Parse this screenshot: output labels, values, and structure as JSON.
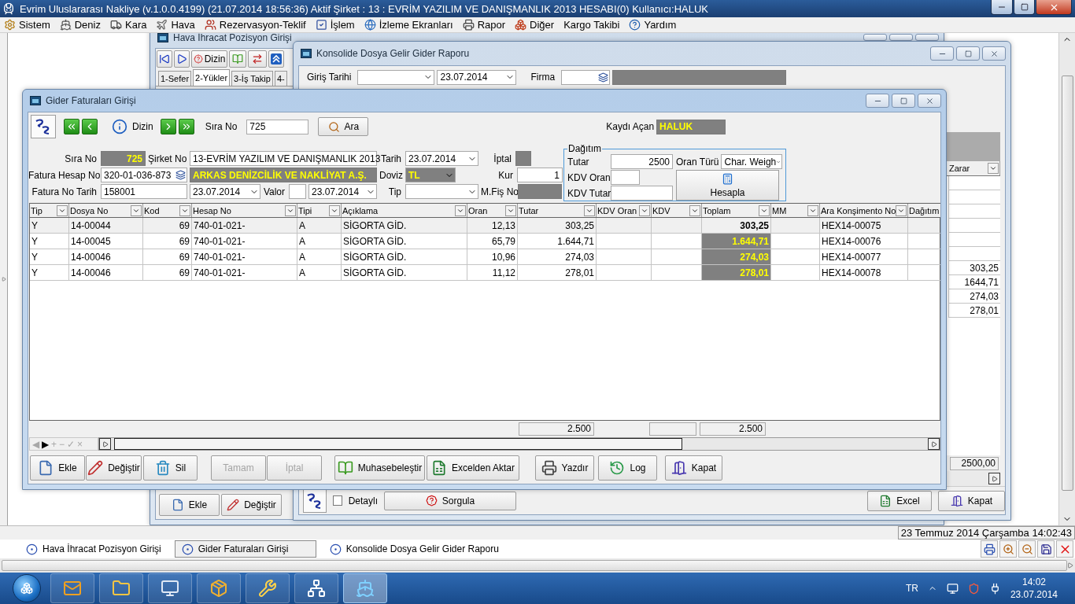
{
  "app": {
    "title": "Evrim Uluslararası Nakliye (v.1.0.0.4199) (21.07.2014 18:56:36) Aktif Şirket : 13 : EVRİM YAZILIM VE DANIŞMANLIK 2013 HESABI(0) Kullanıcı:HALUK"
  },
  "menu": [
    "Sistem",
    "Deniz",
    "Kara",
    "Hava",
    "Rezervasyon-Teklif",
    "İşlem",
    "İzleme Ekranları",
    "Rapor",
    "Diğer",
    "Kargo Takibi",
    "Yardım"
  ],
  "hava_window": {
    "title": "Hava İhracat Pozisyon Girişi",
    "index_button": "Dizin",
    "tabs": [
      {
        "label": "1-Sefer",
        "selected": false
      },
      {
        "label": "2-Yükler",
        "selected": true
      },
      {
        "label": "3-İş Takip",
        "selected": false
      },
      {
        "label": "4-",
        "selected": false
      }
    ],
    "buttons": [
      "Ekle",
      "Değiştir"
    ]
  },
  "konsolide_window": {
    "title": "Konsolide Dosya Gelir Gider Raporu",
    "date_label": "Giriş Tarihi",
    "date_to": "23.07.2014",
    "firma_label": "Firma",
    "column": "Zarar",
    "values": [
      "303,25",
      "1644,71",
      "274,03",
      "278,01"
    ],
    "total": "2500,00",
    "detayli": {
      "label": "Detaylı",
      "checked": false
    },
    "query_button": "Sorgula",
    "buttons": [
      "Excel",
      "Kapat"
    ]
  },
  "gider_window": {
    "title": "Gider Faturaları Girişi",
    "index_button": "Dizin",
    "search_label": "Sıra No",
    "search_value": "725",
    "search_button": "Ara",
    "opened_by_label": "Kaydı Açan",
    "opened_by": "HALUK",
    "form": {
      "sira_no": {
        "label": "Sıra No",
        "value": "725"
      },
      "sirket_no": {
        "label": "Şirket No",
        "value": "13-EVRİM YAZILIM VE DANIŞMANLIK 2013"
      },
      "tarih": {
        "label": "Tarih",
        "value": "23.07.2014"
      },
      "iptal": {
        "label": "İptal"
      },
      "fatura_hesap_no": {
        "label": "Fatura Hesap No",
        "value": "320-01-036-873"
      },
      "firma": {
        "value": "ARKAS DENİZCİLİK VE NAKLİYAT A.Ş."
      },
      "doviz": {
        "label": "Doviz",
        "value": "TL"
      },
      "kur": {
        "label": "Kur",
        "value": "1"
      },
      "fatura_no_tarih": {
        "label": "Fatura No Tarih",
        "value": "158001",
        "date": "23.07.2014"
      },
      "valor": {
        "label": "Valor",
        "date": "23.07.2014"
      },
      "tip": {
        "label": "Tip"
      },
      "mfis_no": {
        "label": "M.Fiş No"
      }
    },
    "dagitim": {
      "title": "Dağıtım",
      "tutar": {
        "label": "Tutar",
        "value": "2500"
      },
      "oran_turu": {
        "label": "Oran Türü",
        "value": "Char. Weigh"
      },
      "kdv_oran": {
        "label": "KDV Oran"
      },
      "kdv_tutar": {
        "label": "KDV Tutar"
      },
      "button": "Hesapla"
    },
    "table": {
      "columns": [
        "Tip",
        "Dosya No",
        "Kod",
        "Hesap No",
        "Tipi",
        "Açıklama",
        "Oran",
        "Tutar",
        "KDV Oran",
        "KDV",
        "Toplam",
        "MM",
        "Ara Konşimento No",
        "Dağıtım"
      ],
      "rows": [
        {
          "tip": "Y",
          "dosya_no": "14-00044",
          "kod": "69",
          "hesap_no": "740-01-021-",
          "tipi": "A",
          "aciklama": "SİGORTA GİD.",
          "oran": "12,13",
          "tutar": "303,25",
          "toplam": "303,25",
          "ara_konsimento_no": "HEX14-00075",
          "selected": true
        },
        {
          "tip": "Y",
          "dosya_no": "14-00045",
          "kod": "69",
          "hesap_no": "740-01-021-",
          "tipi": "A",
          "aciklama": "SİGORTA GİD.",
          "oran": "65,79",
          "tutar": "1.644,71",
          "toplam": "1.644,71",
          "ara_konsimento_no": "HEX14-00076",
          "selected": false
        },
        {
          "tip": "Y",
          "dosya_no": "14-00046",
          "kod": "69",
          "hesap_no": "740-01-021-",
          "tipi": "A",
          "aciklama": "SİGORTA GİD.",
          "oran": "10,96",
          "tutar": "274,03",
          "toplam": "274,03",
          "ara_konsimento_no": "HEX14-00077",
          "selected": false
        },
        {
          "tip": "Y",
          "dosya_no": "14-00046",
          "kod": "69",
          "hesap_no": "740-01-021-",
          "tipi": "A",
          "aciklama": "SİGORTA GİD.",
          "oran": "11,12",
          "tutar": "278,01",
          "toplam": "278,01",
          "ara_konsimento_no": "HEX14-00078",
          "selected": false
        }
      ],
      "totals": {
        "tutar": "2.500",
        "toplam": "2.500"
      }
    },
    "navigator": [
      {
        "symbol": "◀",
        "disabled": true
      },
      {
        "symbol": "▶",
        "disabled": false
      },
      {
        "symbol": "+",
        "disabled": true
      },
      {
        "symbol": "−",
        "disabled": true
      },
      {
        "symbol": "✓",
        "disabled": true
      },
      {
        "symbol": "×",
        "disabled": true
      }
    ],
    "buttons": [
      {
        "label": "Ekle",
        "disabled": false
      },
      {
        "label": "Değiştir",
        "disabled": false
      },
      {
        "label": "Sil",
        "disabled": false
      },
      {
        "label": "Tamam",
        "disabled": true
      },
      {
        "label": "İptal",
        "disabled": true
      },
      {
        "label": "Muhasebeleştir",
        "disabled": false
      },
      {
        "label": "Excelden Aktar",
        "disabled": false
      },
      {
        "label": "Yazdır",
        "disabled": false
      },
      {
        "label": "Log",
        "disabled": false
      },
      {
        "label": "Kapat",
        "disabled": false
      }
    ]
  },
  "status_bar": {
    "datetime": "23 Temmuz 2014 Çarşamba 14:02:43"
  },
  "window_tabs": [
    {
      "label": "Hava İhracat Pozisyon Girişi",
      "selected": false
    },
    {
      "label": "Gider Faturaları Girişi",
      "selected": true
    },
    {
      "label": "Konsolide Dosya Gelir Gider Raporu",
      "selected": false
    }
  ],
  "taskbar": {
    "apps": [
      {
        "selected": false
      },
      {
        "selected": false
      },
      {
        "selected": false
      },
      {
        "selected": false
      },
      {
        "selected": false
      },
      {
        "selected": false
      },
      {
        "selected": true
      }
    ],
    "language": "TR",
    "time": "14:02",
    "date": "23.07.2014"
  }
}
